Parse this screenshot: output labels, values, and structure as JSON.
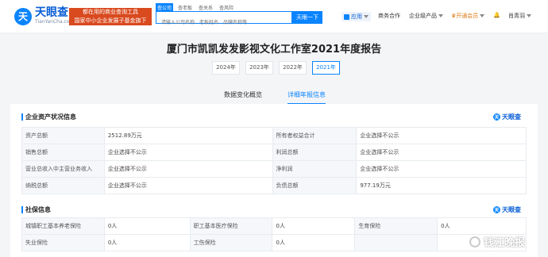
{
  "header": {
    "logo_mark": "天",
    "logo_name": "天眼查",
    "logo_url": "TianYanCha.com",
    "slogan_line1": "都在用的商业查询工具",
    "slogan_line2": "国家中小企业发展子基金旗下机构",
    "search_tabs": [
      "查公司",
      "查老板",
      "查关系",
      "查风险"
    ],
    "search_placeholder": "请输入公司名称、老板姓名、品牌名称等",
    "search_button": "天眼一下",
    "nav_apps": "应用",
    "nav_biz": "商务合作",
    "nav_product": "企业级产品",
    "nav_vip": "开通会员",
    "nav_user": "肖青羽"
  },
  "page_title": "厦门市凯凯发发影视文化工作室2021年度报告",
  "year_tabs": [
    "2024年",
    "2023年",
    "2022年",
    "2021年"
  ],
  "sub_tabs": [
    "数据变化概览",
    "详细年报信息"
  ],
  "assets": {
    "title": "企业资产状况信息",
    "brand": "天眼查",
    "rows": [
      [
        "资产总额",
        "2512.89万元",
        "所有者权益合计",
        "企业选择不公示"
      ],
      [
        "销售总额",
        "企业选择不公示",
        "利润总额",
        "企业选择不公示"
      ],
      [
        "营业总收入中主营业务收入",
        "企业选择不公示",
        "净利润",
        "企业选择不公示"
      ],
      [
        "纳税总额",
        "企业选择不公示",
        "负债总额",
        "977.19万元"
      ]
    ]
  },
  "social": {
    "title": "社保信息",
    "brand": "天眼查",
    "row1": [
      "城镇职工基本养老保险",
      "0人",
      "职工基本医疗保险",
      "0人",
      "生育保险",
      "0人"
    ],
    "row2": [
      "失业保险",
      "0人",
      "工伤保险",
      "0人"
    ]
  },
  "watermark": "钱江晚报",
  "colors": {
    "accent": "#0a84ff",
    "slogan_bg": "#d94a1f",
    "vip": "#e07a15"
  }
}
